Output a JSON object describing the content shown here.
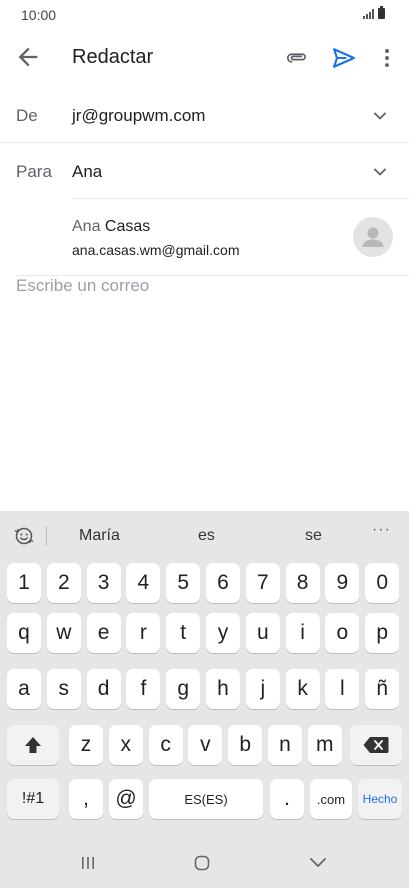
{
  "status_bar": {
    "time": "10:00"
  },
  "app_bar": {
    "title": "Redactar",
    "accent_color": "#1a73e8"
  },
  "from": {
    "label": "De",
    "value": "jr@groupwm.com"
  },
  "to": {
    "label": "Para",
    "value": "Ana"
  },
  "suggestion": {
    "name_match": "Ana",
    "name_rest": " Casas",
    "email": "ana.casas.wm@gmail.com"
  },
  "compose": {
    "placeholder": "Escribe un correo"
  },
  "keyboard": {
    "suggestions": [
      "María",
      "es",
      "se"
    ],
    "more": "···",
    "row_numbers": [
      "1",
      "2",
      "3",
      "4",
      "5",
      "6",
      "7",
      "8",
      "9",
      "0"
    ],
    "row1": [
      "q",
      "w",
      "e",
      "r",
      "t",
      "y",
      "u",
      "i",
      "o",
      "p"
    ],
    "row2": [
      "a",
      "s",
      "d",
      "f",
      "g",
      "h",
      "j",
      "k",
      "l",
      "ñ"
    ],
    "row3": [
      "z",
      "x",
      "c",
      "v",
      "b",
      "n",
      "m"
    ],
    "symbols_key": "!#1",
    "comma_key": ",",
    "at_key": "@",
    "space_key": "ES(ES)",
    "period_key": ".",
    "com_key": ".com",
    "done_key": "Hecho"
  }
}
